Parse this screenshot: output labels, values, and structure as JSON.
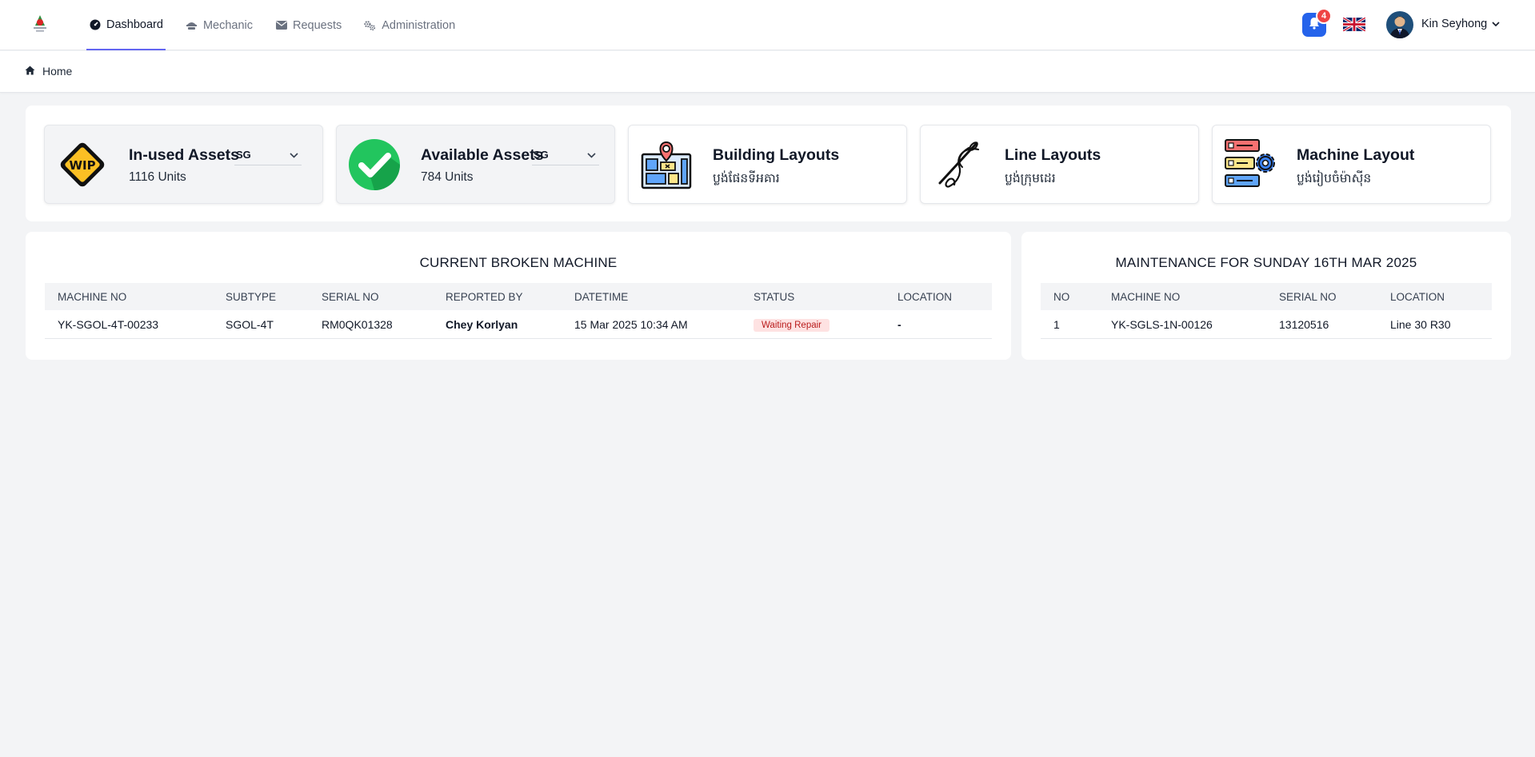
{
  "nav": {
    "items": [
      {
        "label": "Dashboard",
        "icon": "dashboard-icon"
      },
      {
        "label": "Mechanic",
        "icon": "mechanic-icon"
      },
      {
        "label": "Requests",
        "icon": "envelope-icon"
      },
      {
        "label": "Administration",
        "icon": "gears-icon"
      }
    ],
    "active": "Dashboard"
  },
  "header": {
    "notification_count": "4",
    "user_name": "Kin Seyhong",
    "language": "English (UK flag)"
  },
  "breadcrumb": {
    "home_label": "Home"
  },
  "cards": [
    {
      "title": "In-used Assets",
      "subtitle": "1116 Units",
      "select_value": "SG",
      "icon": "wip-icon"
    },
    {
      "title": "Available Assets",
      "subtitle": "784 Units",
      "select_value": "SG",
      "icon": "check-icon"
    },
    {
      "title": "Building Layouts",
      "subtitle": "ប្លង់ផែនទីអគារ",
      "icon": "building-map-icon"
    },
    {
      "title": "Line Layouts",
      "subtitle": "ប្លង់ក្រុមដេរ",
      "icon": "sewing-needle-icon"
    },
    {
      "title": "Machine Layout",
      "subtitle": "ប្លង់រៀបចំម៉ាស៊ីន",
      "icon": "machine-list-icon"
    }
  ],
  "broken": {
    "title": "CURRENT BROKEN MACHINE",
    "columns": [
      "MACHINE NO",
      "SUBTYPE",
      "SERIAL NO",
      "REPORTED BY",
      "DATETIME",
      "STATUS",
      "LOCATION"
    ],
    "rows": [
      {
        "machine_no": "YK-SGOL-4T-00233",
        "subtype": "SGOL-4T",
        "serial_no": "RM0QK01328",
        "reported_by": "Chey Korlyan",
        "datetime": "15 Mar 2025 10:34 AM",
        "status": "Waiting Repair",
        "location": "-"
      }
    ]
  },
  "maintenance": {
    "title": "MAINTENANCE FOR SUNDAY 16TH MAR 2025",
    "columns": [
      "NO",
      "MACHINE NO",
      "SERIAL NO",
      "LOCATION"
    ],
    "rows": [
      {
        "no": "1",
        "machine_no": "YK-SGLS-1N-00126",
        "serial_no": "13120516",
        "location": "Line 30 R30"
      }
    ]
  },
  "colors": {
    "accent": "#6366f1",
    "bell": "#2563eb",
    "badge": "#ef4444",
    "status_bg": "#fee2e2",
    "status_text": "#b91c1c"
  }
}
